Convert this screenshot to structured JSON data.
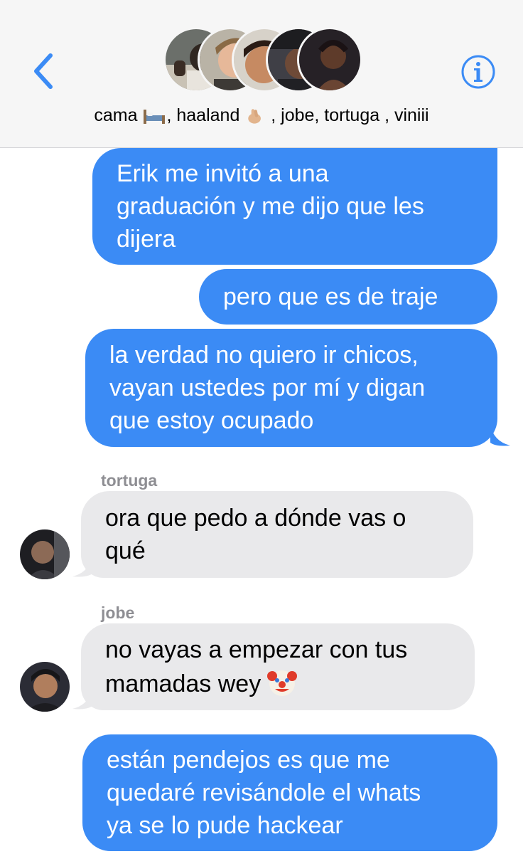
{
  "header": {
    "back_icon": "chevron-left-icon",
    "info_icon": "info-circle-icon",
    "group_title_parts": [
      "cama ",
      ", haaland ",
      " , jobe, tortuga , viniii"
    ],
    "title_emojis": [
      "bed-emoji",
      "crossed-fingers-emoji"
    ],
    "accent_color": "#3b8bf5"
  },
  "messages": [
    {
      "direction": "outgoing",
      "text": "Erik me invitó a una\ngraduación y me dijo que les\ndijera"
    },
    {
      "direction": "outgoing",
      "text": "pero que es de traje"
    },
    {
      "direction": "outgoing",
      "text": "la verdad no quiero ir chicos,\nvayan ustedes por mí y digan\nque estoy ocupado"
    },
    {
      "direction": "incoming",
      "sender": "tortuga",
      "text": "ora que pedo a dónde vas o\nqué"
    },
    {
      "direction": "incoming",
      "sender": "jobe",
      "text": "no vayas a empezar con tus\nmamadas wey",
      "emoji": "clown-face-emoji"
    },
    {
      "direction": "outgoing",
      "text": "están pendejos es que me\nquedaré revisándole el whats\nya se lo pude hackear"
    }
  ],
  "colors": {
    "outgoing_bubble": "#3b8bf5",
    "incoming_bubble": "#e9e9eb",
    "sender_label": "#8e8e93"
  }
}
